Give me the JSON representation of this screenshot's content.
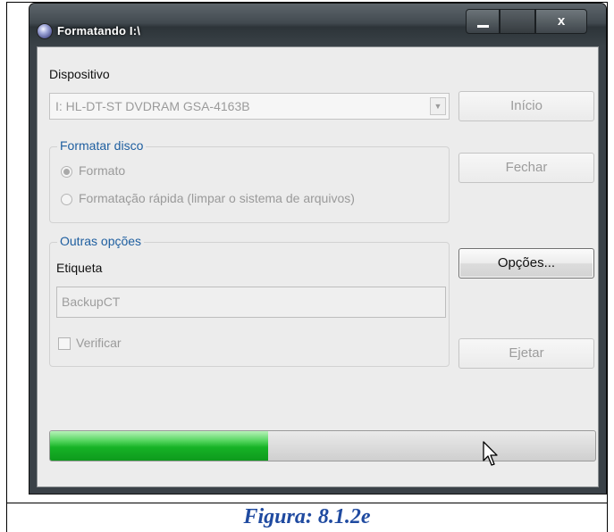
{
  "window": {
    "title": "Formatando I:\\",
    "controls": {
      "minimize": "minimize",
      "maximize": "maximize",
      "close": "x"
    }
  },
  "device": {
    "label": "Dispositivo",
    "selected": "I: HL-DT-ST DVDRAM GSA-4163B"
  },
  "buttons": {
    "start": "Início",
    "close": "Fechar",
    "options": "Opções...",
    "eject": "Ejetar"
  },
  "format_group": {
    "legend": "Formatar disco",
    "options": [
      "Formato",
      "Formatação rápida (limpar o sistema de arquivos)"
    ],
    "selected_index": 0
  },
  "other_group": {
    "legend": "Outras opções",
    "label_caption": "Etiqueta",
    "label_value": "BackupCT",
    "verify_label": "Verificar",
    "verify_checked": false
  },
  "progress": {
    "fraction": 0.4
  },
  "caption": "Figura: 8.1.2e",
  "colors": {
    "progress_fill": "#16b326",
    "legend_text": "#1f5fa0",
    "caption": "#1f4aa0"
  }
}
